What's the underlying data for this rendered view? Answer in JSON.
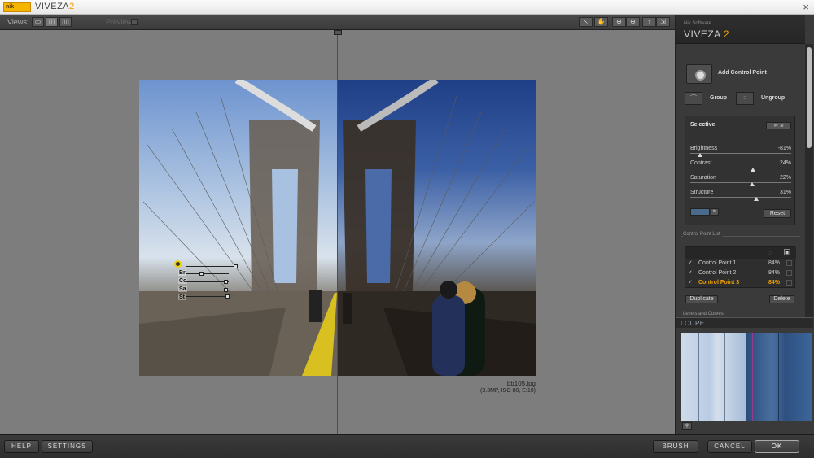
{
  "titlebar": {
    "logo_text": "nik",
    "app_name": "VIVEZA",
    "app_version": "2",
    "close_glyph": "×"
  },
  "toolbar": {
    "views_label": "Views:",
    "preview_label": "Preview:",
    "view_icons": [
      "single-view-icon",
      "split-view-icon",
      "side-by-side-icon"
    ],
    "tool_icons": [
      "arrow-tool-icon",
      "hand-tool-icon",
      "zoom-in-icon",
      "zoom-out-icon",
      "info-icon",
      "fit-icon"
    ]
  },
  "image": {
    "filename": "bb105.jpg",
    "meta": "(3.3MP, ISO 80, E:10)"
  },
  "overlay": {
    "labels": [
      "Br",
      "Co",
      "Sa",
      "St"
    ]
  },
  "panel": {
    "brand_small": "Nik Software",
    "brand_name": "VIVEZA",
    "brand_version": "2",
    "add_control_point": "Add Control Point",
    "group": "Group",
    "ungroup": "Ungroup",
    "selective": {
      "title": "Selective",
      "sliders": [
        {
          "name": "Brightness",
          "value": "-81%",
          "level": 0.095
        },
        {
          "name": "Contrast",
          "value": "24%",
          "level": 0.62
        },
        {
          "name": "Saturation",
          "value": "22%",
          "level": 0.61
        },
        {
          "name": "Structure",
          "value": "31%",
          "level": 0.655
        }
      ],
      "reset": "Reset",
      "swatch_color": "#4b6b8c"
    },
    "control_point_list_title": "Control Point List",
    "control_points": [
      {
        "check": "✓",
        "name": "Control Point 1",
        "percent": "84%"
      },
      {
        "check": "✓",
        "name": "Control Point 2",
        "percent": "84%"
      },
      {
        "check": "✓",
        "name": "Control Point 3",
        "percent": "84%"
      }
    ],
    "duplicate": "Duplicate",
    "delete": "Delete",
    "levels_title": "Levels and Curves",
    "loupe_title": "LOUPE"
  },
  "bottom": {
    "help": "HELP",
    "settings": "SETTINGS",
    "brush": "BRUSH",
    "cancel": "CANCEL",
    "ok": "OK"
  },
  "colors": {
    "accent": "#f0a000",
    "split_line": "#e01010"
  }
}
